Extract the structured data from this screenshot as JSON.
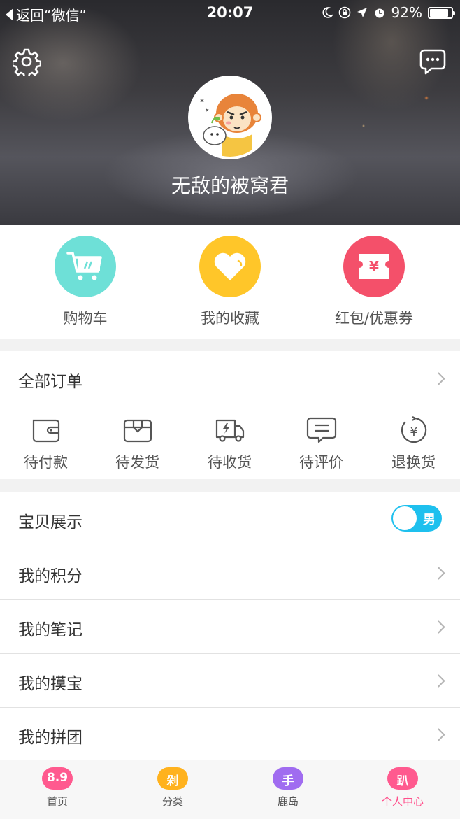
{
  "status_bar": {
    "back_label": "返回“微信”",
    "time": "20:07",
    "battery": "92%",
    "battery_level": 0.92
  },
  "profile": {
    "username": "无敌的被窝君"
  },
  "quick_actions": [
    {
      "label": "购物车",
      "icon": "cart-icon",
      "color": "#6ee0d7"
    },
    {
      "label": "我的收藏",
      "icon": "heart-icon",
      "color": "#ffc629"
    },
    {
      "label": "红包/优惠券",
      "icon": "coupon-icon",
      "color": "#f4506a"
    }
  ],
  "orders": {
    "title": "全部订单",
    "statuses": [
      {
        "label": "待付款",
        "icon": "wallet-icon"
      },
      {
        "label": "待发货",
        "icon": "package-icon"
      },
      {
        "label": "待收货",
        "icon": "truck-icon"
      },
      {
        "label": "待评价",
        "icon": "comment-icon"
      },
      {
        "label": "退换货",
        "icon": "refund-icon"
      }
    ]
  },
  "settings": {
    "display_label": "宝贝展示",
    "toggle_value": "男",
    "toggle_color": "#1ec0ee"
  },
  "menu": [
    {
      "label": "我的积分"
    },
    {
      "label": "我的笔记"
    },
    {
      "label": "我的摸宝"
    },
    {
      "label": "我的拼团"
    }
  ],
  "tabbar": {
    "active_color": "#ff4f8b",
    "tabs": [
      {
        "badge": "8.9",
        "label": "首页",
        "color": "#ff5a8f",
        "icon": "home-tab-icon"
      },
      {
        "badge": "剁",
        "label": "分类",
        "color": "#ffb21e",
        "icon": "category-tab-icon"
      },
      {
        "badge": "手",
        "label": "鹿岛",
        "color": "#a06cf0",
        "icon": "island-tab-icon"
      },
      {
        "badge": "趴",
        "label": "个人中心",
        "color": "#ff5a8f",
        "icon": "profile-tab-icon"
      }
    ]
  }
}
